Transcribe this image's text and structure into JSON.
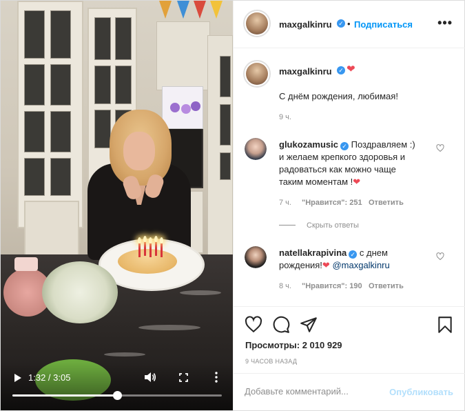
{
  "post": {
    "username": "maxgalkinru",
    "follow_label": "Подписаться",
    "dot": "•",
    "more": "•••",
    "caption_user": "maxgalkinru",
    "caption_heart": "❤",
    "caption_text": "С днём рождения, любимая!",
    "caption_time": "9 ч."
  },
  "comments": [
    {
      "user": "glukozamusic",
      "text_line1": "Поздравляем :)",
      "text_line2": "и желаем крепкого здоровья и",
      "text_line3": "радоваться как можно чаще",
      "text_line4": "таким моментам !",
      "heart": "❤",
      "time": "7 ч.",
      "likes": "\"Нравится\": 251",
      "reply": "Ответить",
      "hide_replies": "Скрыть ответы"
    },
    {
      "user": "natellakrapivina",
      "text_line1": "с днем",
      "text_line2": "рождения!",
      "heart": "❤",
      "mention": "@maxgalkinru",
      "time": "8 ч.",
      "likes": "\"Нравится\": 190",
      "reply": "Ответить"
    }
  ],
  "stats": {
    "views": "Просмотры: 2 010 929",
    "ago": "9 ЧАСОВ НАЗАД"
  },
  "comment_form": {
    "placeholder": "Добавьте комментарий...",
    "publish": "Опубликовать"
  },
  "video": {
    "time": "1:32 / 3:05",
    "progress": 0.5
  },
  "colors": {
    "accent": "#0095f6",
    "verified": "#3897f0",
    "heart": "#ed4956"
  }
}
